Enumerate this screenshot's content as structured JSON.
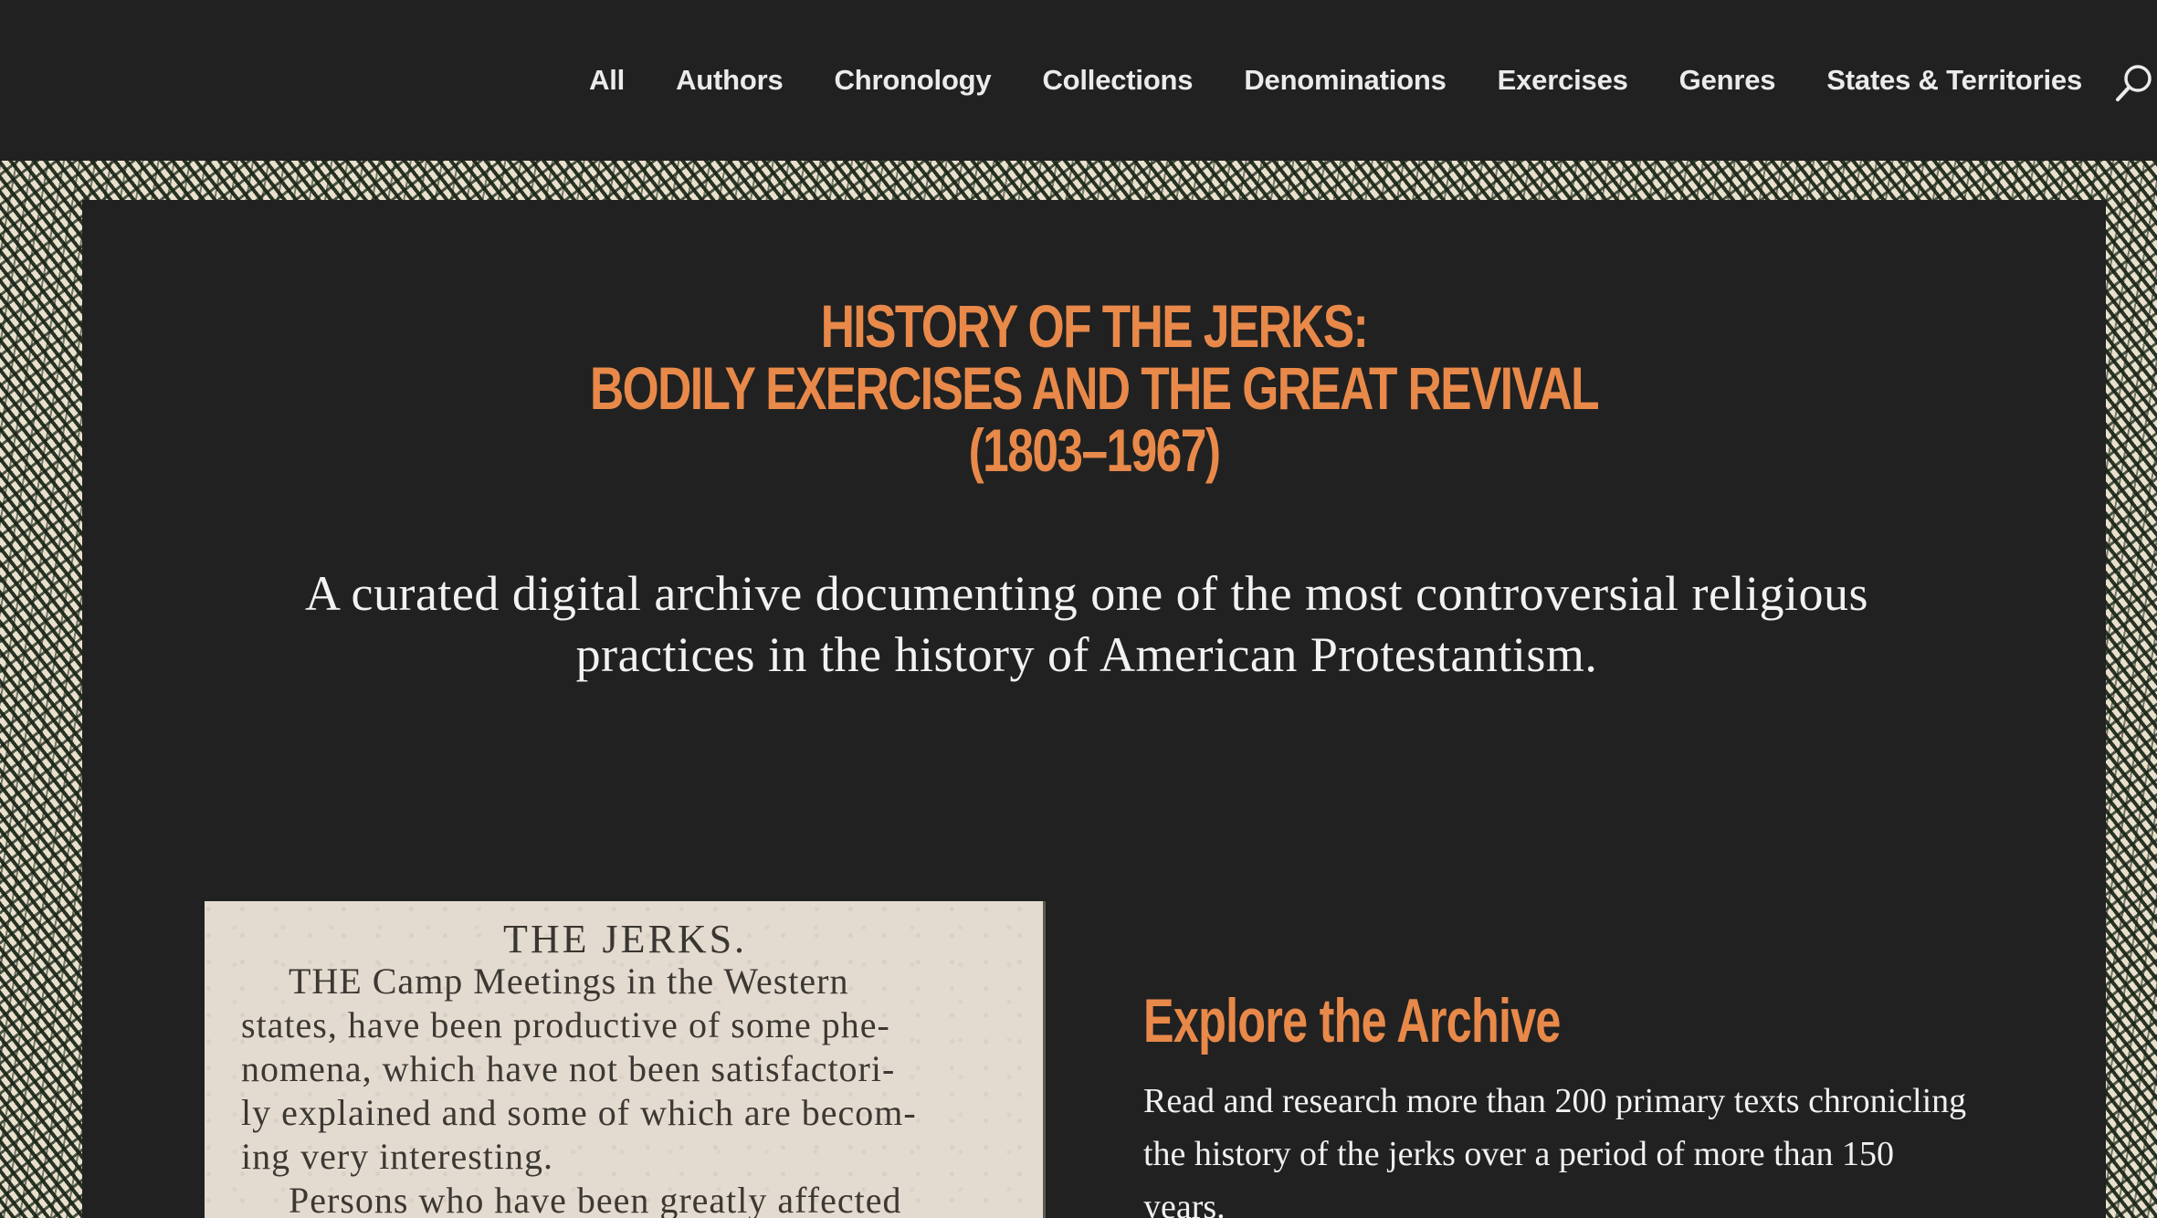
{
  "nav": {
    "items": [
      {
        "label": "All"
      },
      {
        "label": "Authors"
      },
      {
        "label": "Chronology"
      },
      {
        "label": "Collections"
      },
      {
        "label": "Denominations"
      },
      {
        "label": "Exercises"
      },
      {
        "label": "Genres"
      },
      {
        "label": "States & Territories"
      }
    ],
    "search_icon": "search-icon"
  },
  "hero": {
    "title_lines": [
      "HISTORY OF THE JERKS:",
      "BODILY EXERCISES AND THE GREAT REVIVAL",
      "(1803–1967)"
    ],
    "subtitle": "A curated digital archive documenting one of the most controversial religious practices in the history of American Protestantism."
  },
  "clipping": {
    "heading": "THE JERKS.",
    "lines": [
      "THE Camp Meetings in the Western",
      "states, have been productive of some phe-",
      "nomena, which have not been satisfactori-",
      "ly explained and some of which are becom-",
      "ing very interesting.",
      "Persons who have been greatly affected"
    ]
  },
  "explore": {
    "title": "Explore the Archive",
    "body": "Read and research more than 200 primary texts chronicling the history of the jerks over a period of more than 150 years."
  },
  "colors": {
    "background": "#212121",
    "accent": "#e8894a",
    "text": "#f2f2f2"
  }
}
